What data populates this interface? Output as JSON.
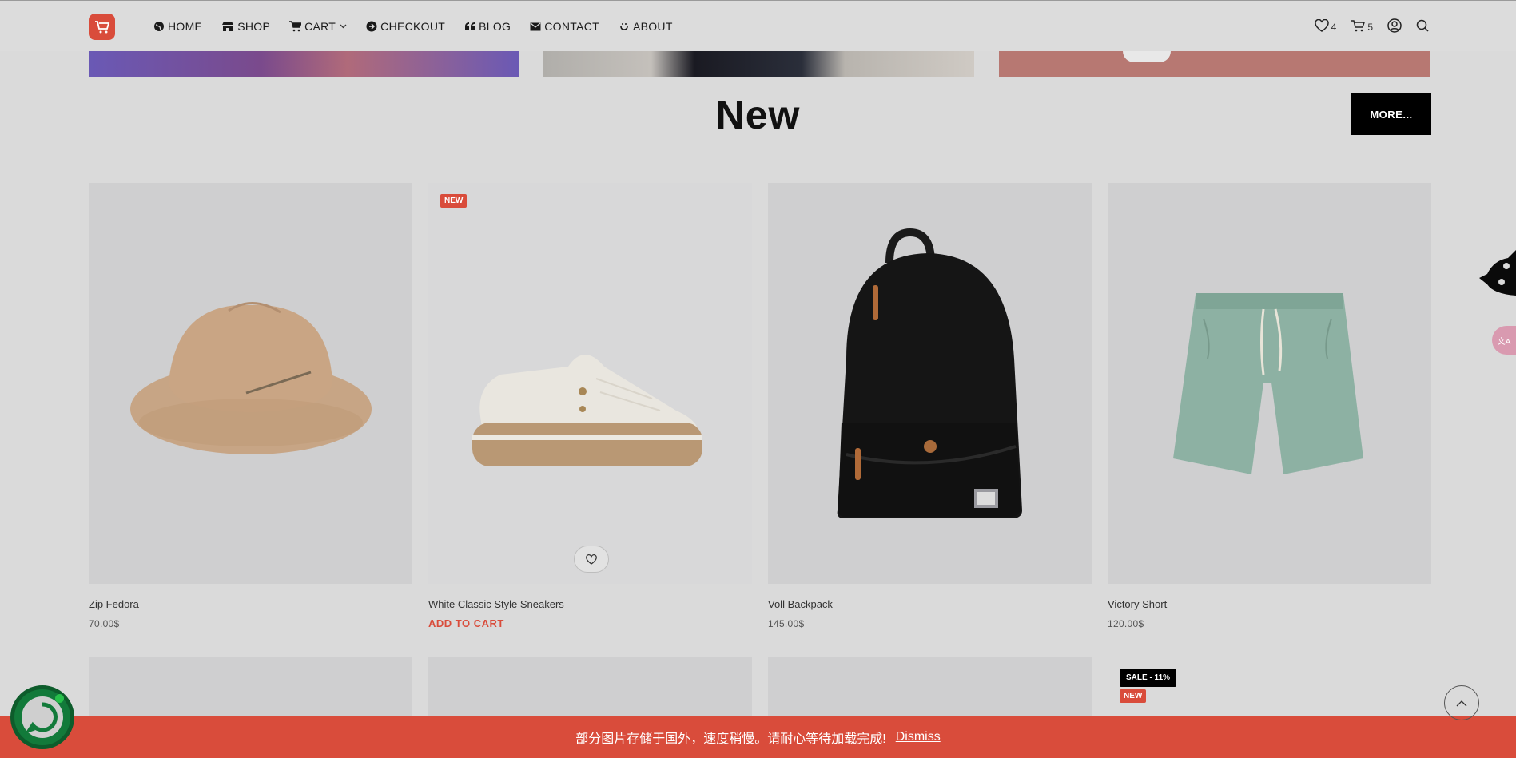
{
  "header": {
    "nav": [
      {
        "label": "HOME",
        "icon": "globe-icon"
      },
      {
        "label": "SHOP",
        "icon": "store-icon"
      },
      {
        "label": "CART",
        "icon": "cart-icon"
      },
      {
        "label": "CHECKOUT",
        "icon": "arrow-circle-icon"
      },
      {
        "label": "BLOG",
        "icon": "quote-icon"
      },
      {
        "label": "CONTACT",
        "icon": "mail-icon"
      },
      {
        "label": "ABOUT",
        "icon": "smile-icon"
      }
    ],
    "wishlist_count": "4",
    "cart_count": "5"
  },
  "section": {
    "title": "New",
    "more_label": "MORE..."
  },
  "products": [
    {
      "name": "Zip Fedora",
      "price": "70.00$"
    },
    {
      "name": "White Classic Style Sneakers",
      "action": "ADD TO CART",
      "badge": "NEW"
    },
    {
      "name": "Voll Backpack",
      "price": "145.00$"
    },
    {
      "name": "Victory Short",
      "price": "120.00$"
    }
  ],
  "row2_badges": {
    "sale": "SALE - 11%",
    "new": "NEW"
  },
  "notice": {
    "text": "部分图片存储于国外，速度稍慢。请耐心等待加载完成!",
    "dismiss": "Dismiss"
  },
  "colors": {
    "accent": "#d94c3b",
    "background": "#dadada"
  }
}
